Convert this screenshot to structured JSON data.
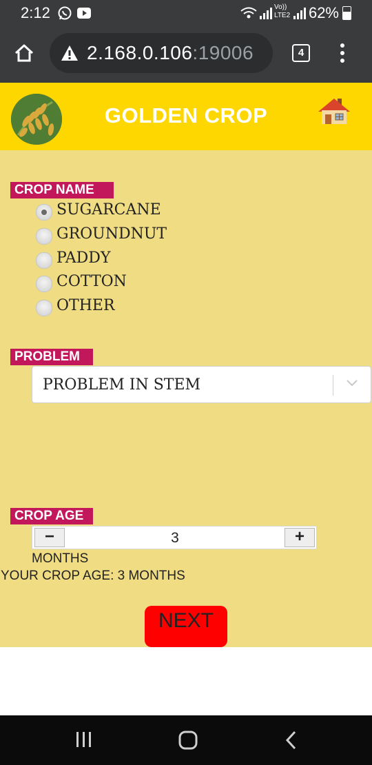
{
  "status_bar": {
    "time": "2:12",
    "battery": "62%",
    "icons": [
      "whatsapp-icon",
      "youtube-icon",
      "wifi-icon",
      "signal-icon",
      "volte-icon",
      "signal-icon",
      "battery-icon"
    ],
    "volte_text": "Vo)) LTE2"
  },
  "browser": {
    "url_host": "2.168.0.106",
    "url_port": ":19006",
    "tab_count": "4"
  },
  "app": {
    "title": "GOLDEN CROP",
    "header_color": "#ffd700",
    "background": "#f0dc82",
    "label_color": "#c2185b"
  },
  "crop_name": {
    "label": "CROP NAME",
    "options": [
      "SUGARCANE",
      "GROUNDNUT",
      "PADDY",
      "COTTON",
      "OTHER"
    ],
    "selected": "SUGARCANE"
  },
  "problem": {
    "label": "PROBLEM",
    "selected": "PROBLEM IN STEM"
  },
  "crop_age": {
    "label": "CROP AGE",
    "minus": "−",
    "plus": "+",
    "value": "3",
    "unit": "MONTHS",
    "summary": "YOUR CROP AGE: 3 MONTHS"
  },
  "next_button": {
    "label": "NEXT",
    "color": "#ff0000"
  }
}
